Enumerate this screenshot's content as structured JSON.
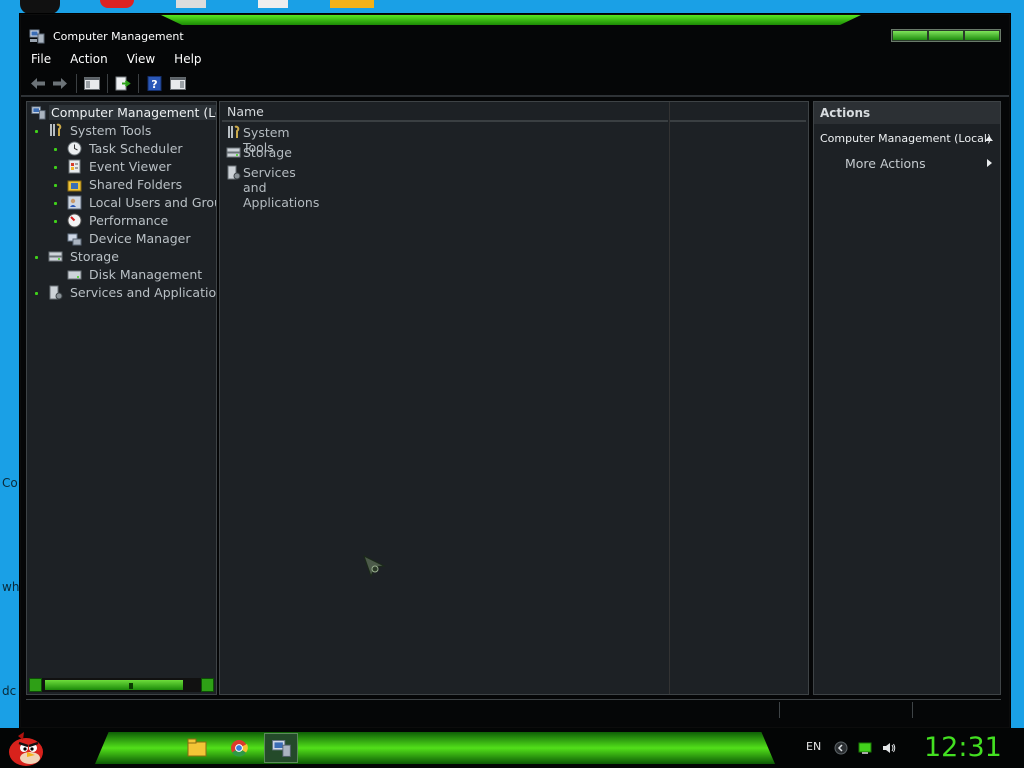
{
  "window": {
    "title": "Computer Management"
  },
  "menu": [
    "File",
    "Action",
    "View",
    "Help"
  ],
  "toolbar": {
    "buttons": [
      "back-icon",
      "forward-icon",
      "show-hide-console-tree-icon",
      "export-list-icon",
      "help-icon",
      "show-hide-action-pane-icon"
    ]
  },
  "tree": {
    "root": "Computer Management (Local)",
    "items": [
      {
        "label": "System Tools",
        "level": 1,
        "icon": "tools-icon"
      },
      {
        "label": "Task Scheduler",
        "level": 2,
        "icon": "clock-icon"
      },
      {
        "label": "Event Viewer",
        "level": 2,
        "icon": "event-viewer-icon"
      },
      {
        "label": "Shared Folders",
        "level": 2,
        "icon": "shared-folders-icon"
      },
      {
        "label": "Local Users and Groups",
        "level": 2,
        "icon": "users-icon"
      },
      {
        "label": "Performance",
        "level": 2,
        "icon": "performance-icon"
      },
      {
        "label": "Device Manager",
        "level": 2,
        "icon": "device-manager-icon"
      },
      {
        "label": "Storage",
        "level": 1,
        "icon": "storage-icon"
      },
      {
        "label": "Disk Management",
        "level": 2,
        "icon": "disk-icon"
      },
      {
        "label": "Services and Applications",
        "level": 1,
        "icon": "services-icon"
      }
    ]
  },
  "list": {
    "column_header": "Name",
    "rows": [
      "System Tools",
      "Storage",
      "Services and Applications"
    ]
  },
  "actions": {
    "header": "Actions",
    "section": "Computer Management (Local)",
    "more": "More Actions"
  },
  "taskbar": {
    "language": "EN",
    "clock": "12:31"
  },
  "desktop_fragments": [
    "Co",
    "wh",
    "dc"
  ],
  "colors": {
    "accent_green": "#43e021",
    "pane_bg": "#1d2125",
    "desktop_blue": "#1aa0e6"
  }
}
